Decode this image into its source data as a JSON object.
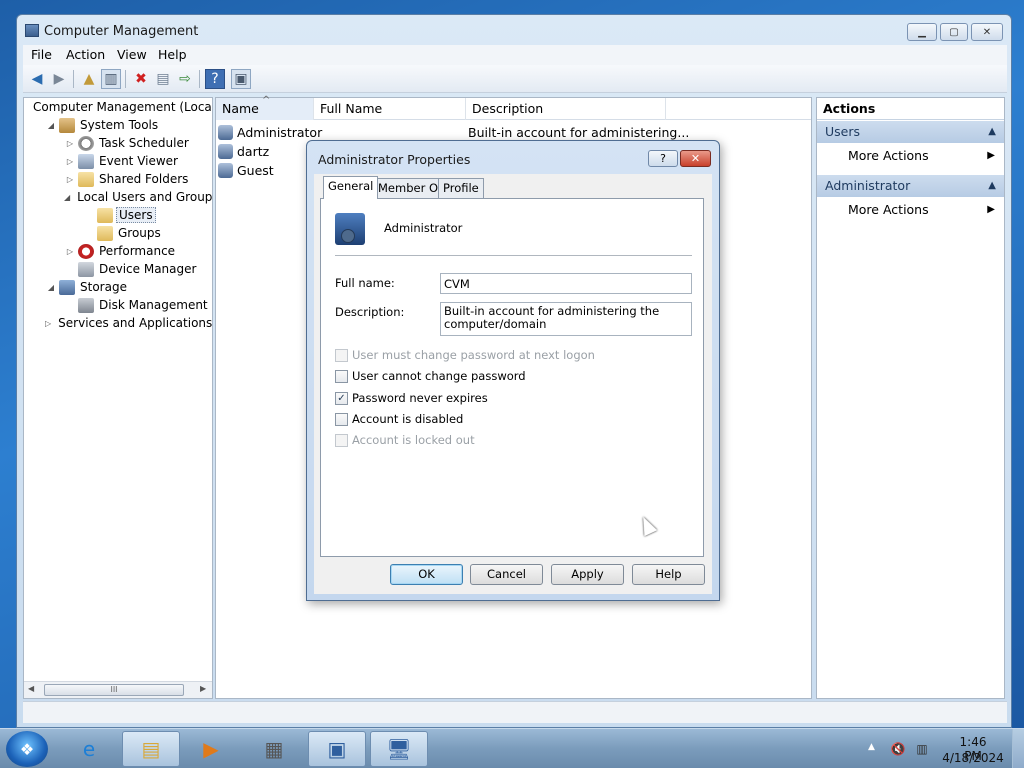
{
  "window": {
    "title": "Computer Management",
    "controls": {
      "minimize": "▭",
      "maximize": "▭",
      "close": "✕"
    }
  },
  "menubar": [
    "File",
    "Action",
    "View",
    "Help"
  ],
  "toolbar": {
    "icons": [
      "back-arrow-icon",
      "forward-arrow-icon",
      "up-folder-icon",
      "show-hide-tree-icon",
      "delete-icon",
      "properties-icon",
      "export-list-icon",
      "help-icon",
      "show-hide-action-pane-icon"
    ]
  },
  "tree": {
    "items": [
      {
        "label": "Computer Management (Local",
        "icon": "computer-icon",
        "level": 0,
        "expander": ""
      },
      {
        "label": "System Tools",
        "icon": "tools-icon",
        "level": 1,
        "expander": "◢"
      },
      {
        "label": "Task Scheduler",
        "icon": "clock-icon",
        "level": 2,
        "expander": "▷"
      },
      {
        "label": "Event Viewer",
        "icon": "event-viewer-icon",
        "level": 2,
        "expander": "▷"
      },
      {
        "label": "Shared Folders",
        "icon": "shared-folder-icon",
        "level": 2,
        "expander": "▷"
      },
      {
        "label": "Local Users and Groups",
        "icon": "users-groups-icon",
        "level": 2,
        "expander": "◢"
      },
      {
        "label": "Users",
        "icon": "folder-icon",
        "level": 3,
        "expander": "",
        "selected": true
      },
      {
        "label": "Groups",
        "icon": "folder-icon",
        "level": 3,
        "expander": ""
      },
      {
        "label": "Performance",
        "icon": "performance-icon",
        "level": 2,
        "expander": "▷"
      },
      {
        "label": "Device Manager",
        "icon": "device-manager-icon",
        "level": 2,
        "expander": ""
      },
      {
        "label": "Storage",
        "icon": "storage-icon",
        "level": 1,
        "expander": "◢"
      },
      {
        "label": "Disk Management",
        "icon": "disk-icon",
        "level": 2,
        "expander": ""
      },
      {
        "label": "Services and Applications",
        "icon": "services-icon",
        "level": 1,
        "expander": "▷"
      }
    ],
    "scroll_left": "◀",
    "scroll_right": "▶",
    "scroll_grip": "III"
  },
  "list": {
    "columns": [
      "Name",
      "Full Name",
      "Description"
    ],
    "sort_indicator": "^",
    "rows": [
      {
        "name": "Administrator",
        "full_name": "",
        "description": "Built-in account for administering..."
      },
      {
        "name": "dartz",
        "full_name": "",
        "description": ""
      },
      {
        "name": "Guest",
        "full_name": "",
        "description": ""
      }
    ]
  },
  "actions": {
    "title": "Actions",
    "sections": [
      {
        "header": "Users",
        "item": "More Actions"
      },
      {
        "header": "Administrator",
        "item": "More Actions"
      }
    ],
    "collapse_glyph": "▲",
    "submenu_glyph": "▶"
  },
  "dialog": {
    "title": "Administrator Properties",
    "help_glyph": "?",
    "close_glyph": "✕",
    "tabs": [
      "General",
      "Member Of",
      "Profile"
    ],
    "user_name": "Administrator",
    "full_name_label": "Full name:",
    "full_name_value": "CVM",
    "description_label": "Description:",
    "description_value": "Built-in account for administering the computer/domain",
    "checkboxes": [
      {
        "label": "User must change password at next logon",
        "checked": false,
        "disabled": true
      },
      {
        "label": "User cannot change password",
        "checked": false,
        "disabled": false
      },
      {
        "label": "Password never expires",
        "checked": true,
        "disabled": false
      },
      {
        "label": "Account is disabled",
        "checked": false,
        "disabled": false
      },
      {
        "label": "Account is locked out",
        "checked": false,
        "disabled": true
      }
    ],
    "check_glyph": "✓",
    "buttons": [
      "OK",
      "Cancel",
      "Apply",
      "Help"
    ]
  },
  "taskbar": {
    "start_glyph": "❖",
    "apps": [
      {
        "name": "internet-explorer-icon",
        "glyph": "e",
        "active": false
      },
      {
        "name": "file-explorer-icon",
        "glyph": "▤",
        "active": true
      },
      {
        "name": "media-player-icon",
        "glyph": "▶",
        "active": false
      },
      {
        "name": "notepad-icon",
        "glyph": "▦",
        "active": false
      },
      {
        "name": "control-panel-icon",
        "glyph": "▣",
        "active": true
      },
      {
        "name": "computer-management-icon",
        "glyph": "🖥",
        "active": true
      }
    ],
    "tray_up": "▲",
    "tray_icons": [
      "volume-muted-icon",
      "network-icon"
    ],
    "time": "1:46 PM",
    "date": "4/18/2024"
  }
}
